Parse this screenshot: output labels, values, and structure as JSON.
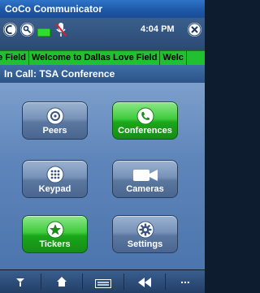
{
  "window": {
    "title": "CoCo Communicator"
  },
  "status": {
    "time": "4:04 PM"
  },
  "ticker": {
    "items": [
      "ve Field",
      "Welcome to Dallas Love Field",
      "Welc"
    ]
  },
  "call": {
    "status": "In Call: TSA Conference"
  },
  "tiles": [
    {
      "label": "Peers",
      "icon": "peers-icon",
      "active": false
    },
    {
      "label": "Conferences",
      "icon": "phone-icon",
      "active": true
    },
    {
      "label": "Keypad",
      "icon": "keypad-icon",
      "active": false
    },
    {
      "label": "Cameras",
      "icon": "camera-icon",
      "active": false
    },
    {
      "label": "Tickers",
      "icon": "star-icon",
      "active": true
    },
    {
      "label": "Settings",
      "icon": "gear-icon",
      "active": false
    }
  ],
  "bottom_bar": {
    "more_label": "..."
  },
  "colors": {
    "ticker_bg": "#20c030",
    "active_tile": "#3fcb3c",
    "inactive_tile": "#7792b8",
    "title_bar": "#1d56a6"
  }
}
